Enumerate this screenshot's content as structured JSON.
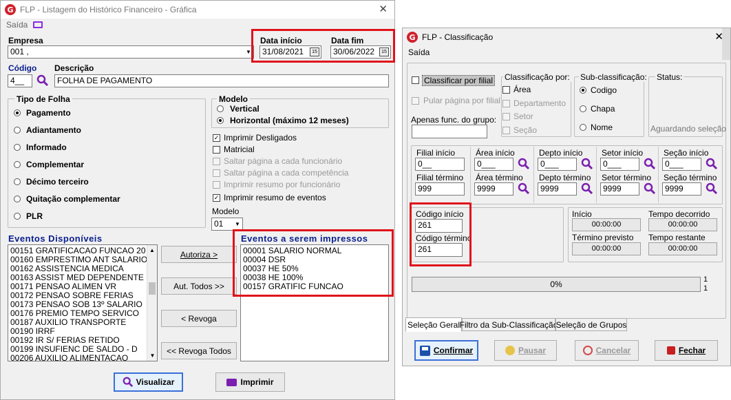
{
  "win1": {
    "title": "FLP - Listagem do Histórico Financeiro - Gráfica",
    "menu_saida": "Saída",
    "empresa_label": "Empresa",
    "empresa_value": "001 ,",
    "data_inicio_label": "Data início",
    "data_inicio_value": "31/08/2021",
    "data_fim_label": "Data fim",
    "data_fim_value": "30/06/2022",
    "codigo_label": "Código",
    "codigo_value": "4__",
    "descricao_label": "Descrição",
    "descricao_value": "FOLHA DE PAGAMENTO",
    "tipo_folha_label": "Tipo de Folha",
    "tipo_folha_options": [
      "Pagamento",
      "Adiantamento",
      "Informado",
      "Complementar",
      "Décimo terceiro",
      "Quitação complementar",
      "PLR"
    ],
    "modelo_group_label": "Modelo",
    "modelo_options": [
      "Vertical",
      "Horizontal (máximo 12 meses)"
    ],
    "checks": [
      "Imprimir Desligados",
      "Matricial",
      "Saltar página a cada funcionário",
      "Saltar página a cada competência",
      "Imprimir resumo por funcionário",
      "Imprimir resumo de eventos"
    ],
    "modelo_select_label": "Modelo",
    "modelo_select_value": "01",
    "eventos_disp_label": "Eventos Disponíveis",
    "eventos_disp": [
      "00151 GRATIFICACAO FUNCAO 20",
      "00160 EMPRESTIMO ANT SALARIO",
      "00162 ASSISTENCIA MEDICA",
      "00163 ASSIST MED DEPENDENTE",
      "00171 PENSAO ALIMEN VR",
      "00172 PENSAO SOBRE FERIAS",
      "00173 PENSAO SOB 13º SALARIO",
      "00176 PREMIO TEMPO SERVICO",
      "00187 AUXILIO TRANSPORTE",
      "00190 IRRF",
      "00192 IR S/ FERIAS RETIDO",
      "00199 INSUFIENC DE SALDO - D",
      "00206 AUXILIO ALIMENTACAO"
    ],
    "btn_autoriza": "Autoriza >",
    "btn_aut_todos": "Aut. Todos >>",
    "btn_revoga": "< Revoga",
    "btn_revoga_todos": "<< Revoga Todos",
    "eventos_imp_label": "Eventos a serem impressos",
    "eventos_imp": [
      "00001 SALARIO NORMAL",
      "00004 DSR",
      "00037 HE 50%",
      "00038 HE 100%",
      "00157 GRATIFIC FUNCAO"
    ],
    "btn_visualizar": "Visualizar",
    "btn_imprimir": "Imprimir"
  },
  "win2": {
    "title": "FLP - Classificação",
    "menu_saida": "Saída",
    "classificar_por_filial": "Classificar por filial",
    "pular_pagina": "Pular página por filial",
    "apenas_func_label": "Apenas func. do grupo:",
    "classificacao_label": "Classificação  por:",
    "classificacao_options": [
      "Área",
      "Departamento",
      "Setor",
      "Seção"
    ],
    "subclass_label": "Sub-classificação:",
    "subclass_options": [
      "Codigo",
      "Chapa",
      "Nome"
    ],
    "status_label": "Status:",
    "status_value": "Aguardando seleção",
    "filial_inicio_label": "Filial início",
    "filial_inicio_value": "0__",
    "filial_termino_label": "Filial término",
    "filial_termino_value": "999",
    "area_inicio_label": "Área início",
    "area_inicio_value": "0___",
    "area_termino_label": "Área término",
    "area_termino_value": "9999",
    "depto_inicio_label": "Depto início",
    "depto_inicio_value": "0___",
    "depto_termino_label": "Depto término",
    "depto_termino_value": "9999",
    "setor_inicio_label": "Setor início",
    "setor_inicio_value": "0___",
    "setor_termino_label": "Setor término",
    "setor_termino_value": "9999",
    "secao_inicio_label": "Seção início",
    "secao_inicio_value": "0___",
    "secao_termino_label": "Seção término",
    "secao_termino_value": "9999",
    "codigo_inicio_label": "Código início",
    "codigo_inicio_value": "261",
    "codigo_termino_label": "Código término",
    "codigo_termino_value": "261",
    "inicio_label": "Início",
    "inicio_value": "00:00:00",
    "tempo_decorrido_label": "Tempo decorrido",
    "tempo_decorrido_value": "00:00:00",
    "termino_previsto_label": "Término previsto",
    "termino_previsto_value": "00:00:00",
    "tempo_restante_label": "Tempo restante",
    "tempo_restante_value": "00:00:00",
    "progress_text": "0%",
    "progress_fraction": 0,
    "counter_top": "1",
    "counter_bottom": "1",
    "tabs": [
      "Seleção Geral",
      "Filtro da Sub-Classificação",
      "Seleção de Grupos"
    ],
    "btn_confirmar": "Confirmar",
    "btn_pausar": "Pausar",
    "btn_cancelar": "Cancelar",
    "btn_fechar": "Fechar"
  },
  "colors": {
    "highlight": "#e0121a",
    "label_blue": "#0a1e8c",
    "search_icon": "#7a1fb0",
    "logo": "#d0202a"
  }
}
